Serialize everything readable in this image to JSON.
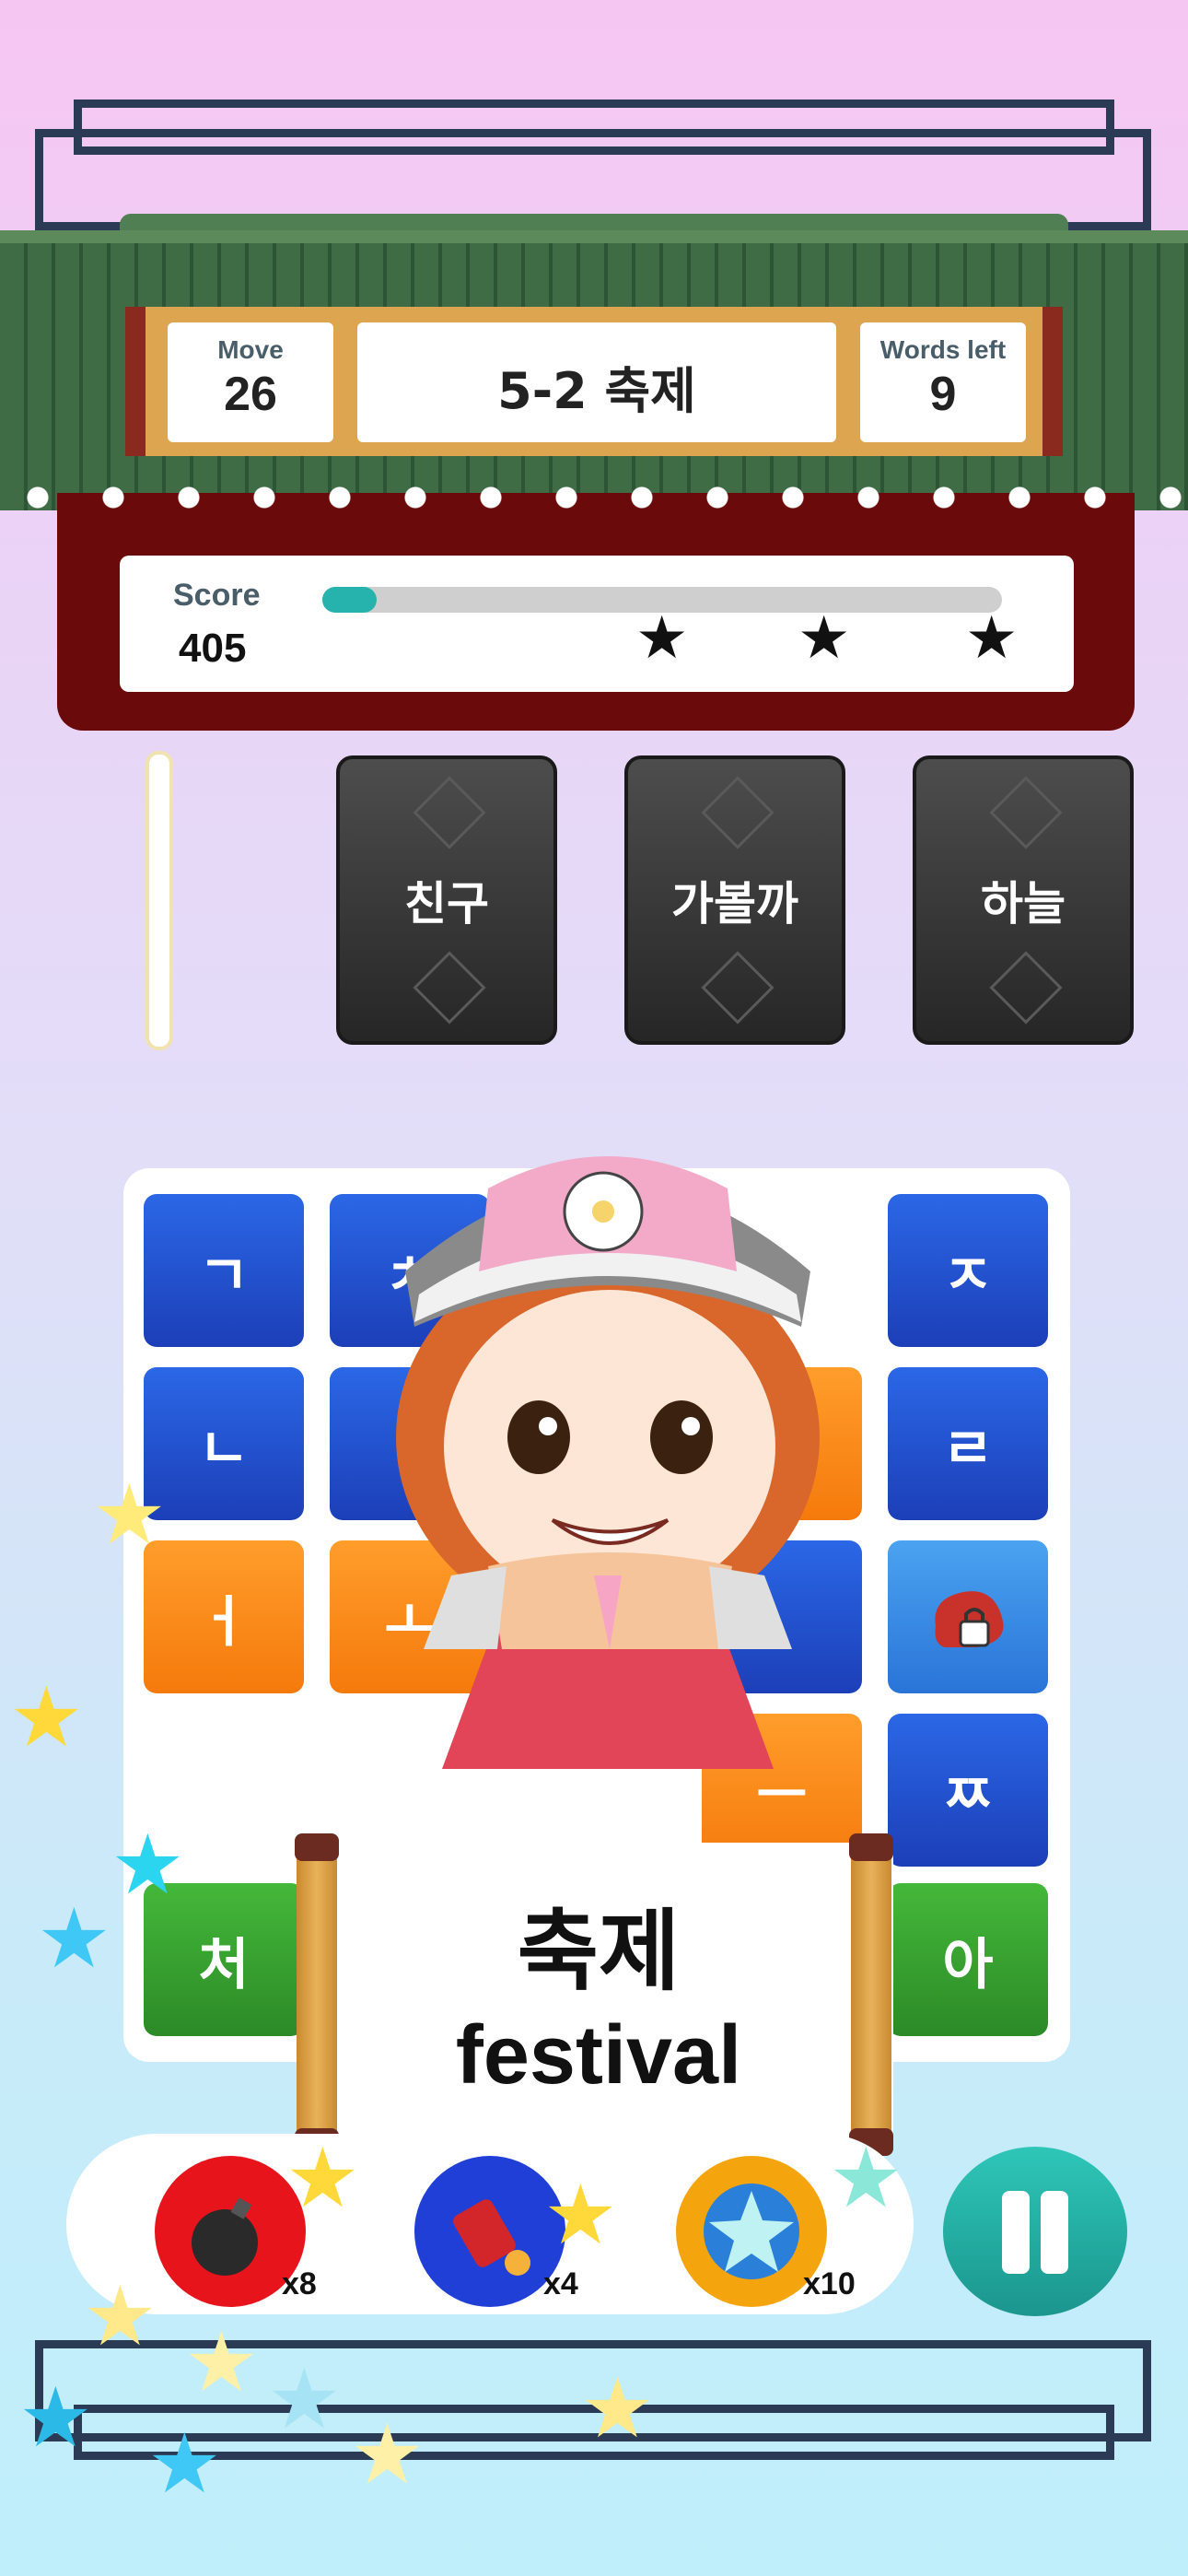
{
  "hud": {
    "move_label": "Move",
    "move_value": "26",
    "level_title": "5-2 축제",
    "words_left_label": "Words left",
    "words_left_value": "9"
  },
  "score": {
    "label": "Score",
    "value": "405",
    "progress_fraction": 0.08,
    "stars_total": 3
  },
  "word_cards": [
    "친구",
    "가볼까",
    "하늘"
  ],
  "board": {
    "tiles": [
      {
        "text": "ㄱ",
        "color": "blue"
      },
      {
        "text": "ㅊ",
        "color": "blue"
      },
      {
        "text": "ㅈ",
        "color": "blue"
      },
      {
        "text": "ㄴ",
        "color": "blue"
      },
      {
        "text": "ㄹ",
        "color": "blue"
      },
      {
        "text": "ㅓ",
        "color": "orange"
      },
      {
        "text": "ㅗ",
        "color": "orange"
      },
      {
        "text": "",
        "color": "lightblue",
        "locked": true
      },
      {
        "text": "ㅡ",
        "color": "orange"
      },
      {
        "text": "ㅉ",
        "color": "blue"
      },
      {
        "text": "처",
        "color": "green"
      },
      {
        "text": "아",
        "color": "green"
      }
    ]
  },
  "popup": {
    "korean": "축제",
    "english": "festival"
  },
  "powerups": [
    {
      "name": "bomb",
      "icon": "bomb-icon",
      "count": "x8",
      "color": "#e8141c"
    },
    {
      "name": "rocket",
      "icon": "rocket-icon",
      "count": "x4",
      "color": "#1f3fd6"
    },
    {
      "name": "star",
      "icon": "star-icon",
      "count": "x10",
      "color": "#f4a50e"
    }
  ],
  "pause_icon": "pause-icon"
}
